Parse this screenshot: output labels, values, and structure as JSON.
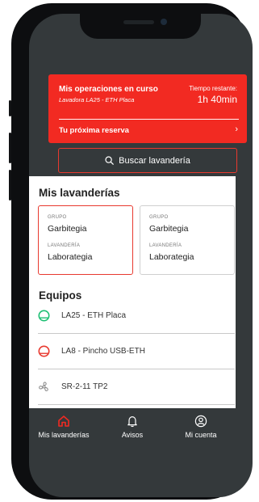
{
  "operations": {
    "title": "Mis operaciones en curso",
    "device": "Lavadora LA25 - ETH Placa",
    "time_label": "Tiempo restante:",
    "time_value": "1h 40min",
    "next_reservation": "Tu próxima reserva",
    "chevron": "›"
  },
  "search": {
    "label": "Buscar lavandería",
    "icon": "search-icon"
  },
  "laundries": {
    "title": "Mis lavanderías",
    "cards": [
      {
        "group_caption": "GRUPO",
        "group": "Garbitegia",
        "laundry_caption": "LAVANDERÍA",
        "laundry": "Laborategia",
        "selected": true
      },
      {
        "group_caption": "GRUPO",
        "group": "Garbitegia",
        "laundry_caption": "LAVANDERÍA",
        "laundry": "Laborategia",
        "selected": false
      }
    ]
  },
  "equipment": {
    "title": "Equipos",
    "items": [
      {
        "label": "LA25 - ETH Placa",
        "icon": "washer-status-icon",
        "color": "#1dbf73"
      },
      {
        "label": "LA8 - Pincho USB-ETH",
        "icon": "washer-status-icon",
        "color": "#e8392f"
      },
      {
        "label": "SR-2-11 TP2",
        "icon": "dryer-fan-icon",
        "color": "#888888"
      }
    ]
  },
  "nav": {
    "items": [
      {
        "label": "Mis lavanderías",
        "icon": "home-icon",
        "active": true
      },
      {
        "label": "Avisos",
        "icon": "bell-icon",
        "active": false
      },
      {
        "label": "Mi cuenta",
        "icon": "account-icon",
        "active": false
      }
    ]
  },
  "colors": {
    "accent": "#f22a22",
    "dark": "#34393b",
    "success": "#1dbf73"
  }
}
